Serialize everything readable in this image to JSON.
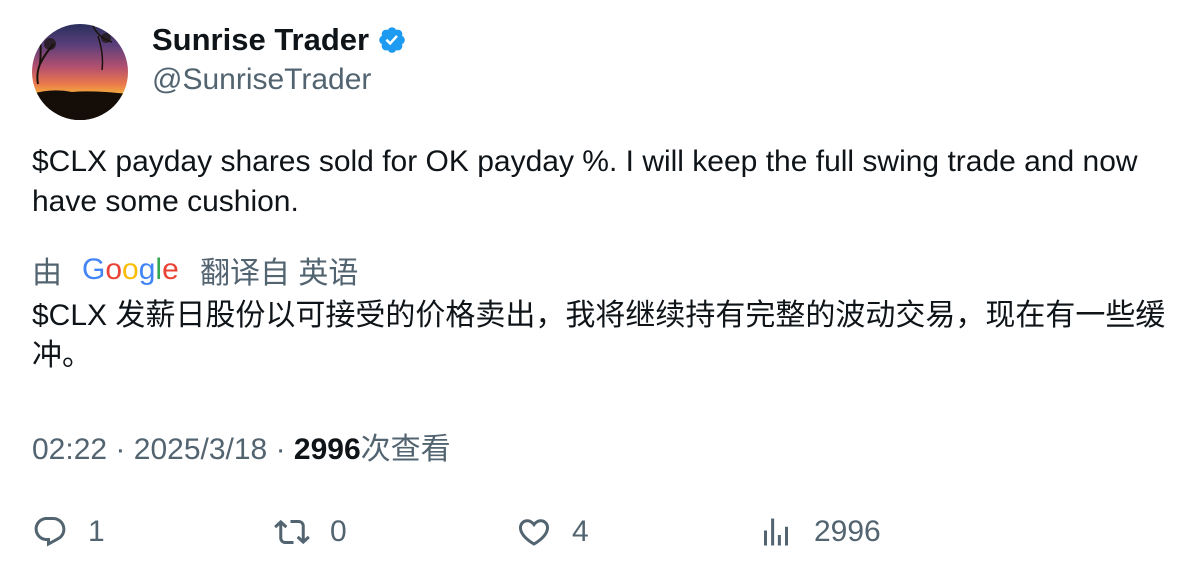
{
  "author": {
    "display_name": "Sunrise Trader",
    "handle": "@SunriseTrader",
    "verified": true,
    "avatar_icon": "sunset-photo"
  },
  "tweet": {
    "text": "$CLX payday shares sold for OK payday %.  I will keep the full swing trade and now have some cushion."
  },
  "translation": {
    "prefix": "由",
    "provider": "Google",
    "suffix": "翻译自 英语",
    "text": "$CLX 发薪日股份以可接受的价格卖出，我将继续持有完整的波动交易，现在有一些缓冲。"
  },
  "meta": {
    "time": "02:22",
    "separator": "·",
    "date": "2025/3/18",
    "views_count": "2996",
    "views_label": "次查看"
  },
  "actions": {
    "replies": "1",
    "retweets": "0",
    "likes": "4",
    "views": "2996"
  },
  "colors": {
    "verified_blue": "#1d9bf0",
    "muted_text": "#536471",
    "main_text": "#0f1419"
  }
}
